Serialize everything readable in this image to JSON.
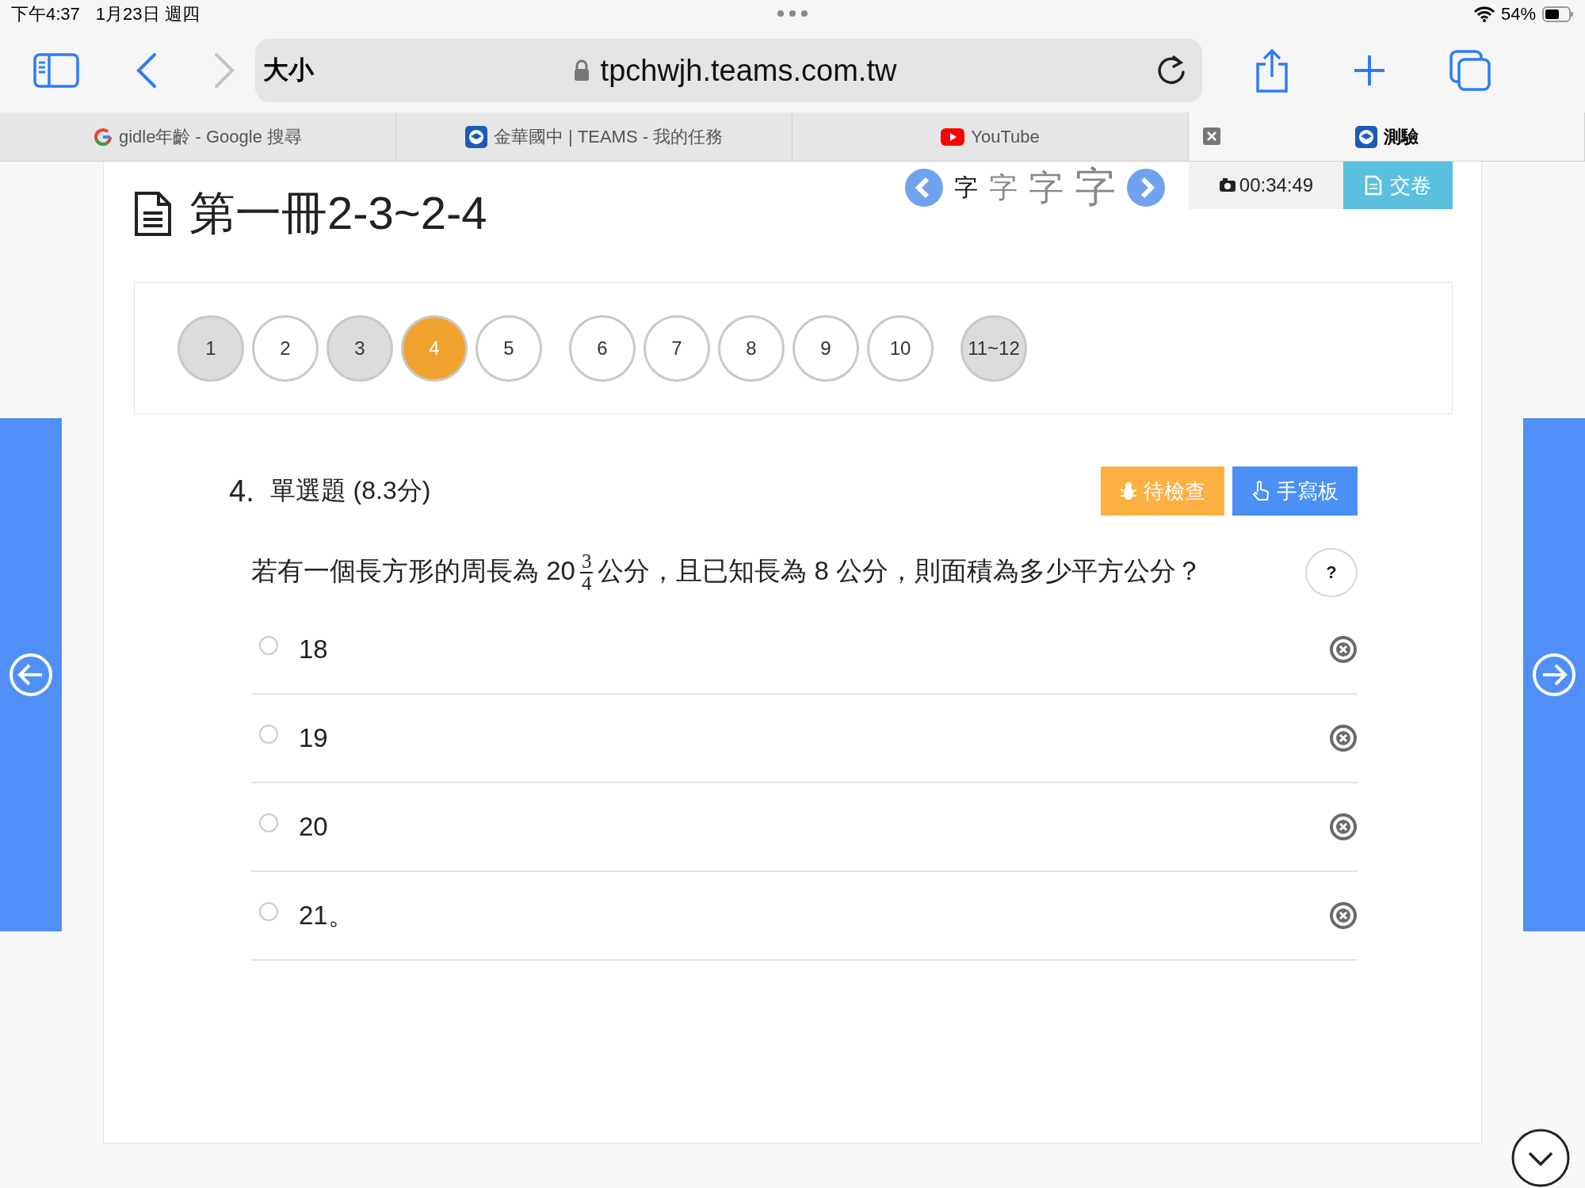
{
  "status_bar": {
    "time": "下午4:37",
    "date": "1月23日 週四",
    "battery": "54%"
  },
  "toolbar": {
    "text_size": "大小",
    "url": "tpchwjh.teams.com.tw"
  },
  "tabs": [
    {
      "kind": "google",
      "label": "gidle年齡 - Google 搜尋",
      "selected": false
    },
    {
      "kind": "teams",
      "label": "金華國中 | TEAMS - 我的任務",
      "selected": false
    },
    {
      "kind": "youtube",
      "label": "YouTube",
      "selected": false
    },
    {
      "kind": "teams",
      "label": "測驗",
      "selected": true,
      "closable": true
    }
  ],
  "page": {
    "title": "第一冊2-3~2-4",
    "font_sizes": [
      {
        "label": "字",
        "selected": true
      },
      {
        "label": "字",
        "selected": false
      },
      {
        "label": "字",
        "selected": false
      },
      {
        "label": "字",
        "selected": false
      }
    ],
    "timer": "00:34:49",
    "submit": "交卷",
    "question_nav": [
      {
        "label": "1",
        "answered": true,
        "selected": false
      },
      {
        "label": "2",
        "answered": false,
        "selected": false
      },
      {
        "label": "3",
        "answered": true,
        "selected": false
      },
      {
        "label": "4",
        "answered": false,
        "selected": true
      },
      {
        "label": "5",
        "answered": false,
        "selected": false
      },
      {
        "label": "6",
        "answered": false,
        "selected": false
      },
      {
        "label": "7",
        "answered": false,
        "selected": false
      },
      {
        "label": "8",
        "answered": false,
        "selected": false
      },
      {
        "label": "9",
        "answered": false,
        "selected": false
      },
      {
        "label": "10",
        "answered": false,
        "selected": false
      },
      {
        "label": "11~12",
        "answered": true,
        "selected": false
      }
    ],
    "question": {
      "number": "4.",
      "type": "單選題 (8.3分)",
      "review_button": "待檢查",
      "handwriting_button": "手寫板",
      "text_before": "若有一個長方形的周長為 20",
      "fraction_numerator": "3",
      "fraction_denominator": "4",
      "text_after": "公分，且已知長為 8 公分，則面積為多少平方公分？",
      "help": "?",
      "options": [
        {
          "label": "18",
          "selected": false
        },
        {
          "label": "19",
          "selected": false
        },
        {
          "label": "20",
          "selected": false
        },
        {
          "label": "21。",
          "selected": false
        }
      ]
    }
  }
}
